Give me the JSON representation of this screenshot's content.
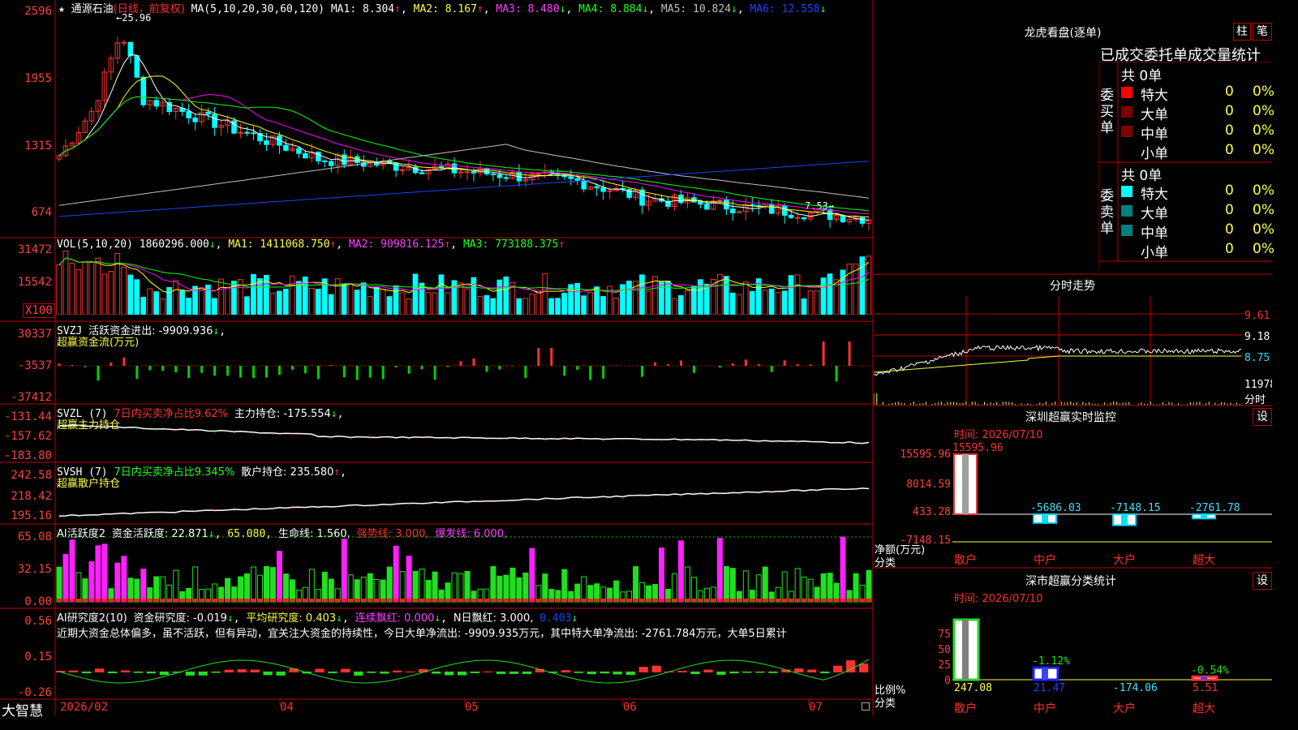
{
  "stock": {
    "name": "通源石油",
    "mode": "(日线，前复权)"
  },
  "colors": {
    "up": "#ff3232",
    "down": "#00ffff",
    "ma1": "#ffffff",
    "ma2": "#ffff00",
    "ma3": "#ff00ff",
    "ma4": "#00ff00",
    "ma5": "#c0c0c0",
    "ma6": "#2040ff",
    "grid": "#c00000"
  },
  "main": {
    "ma_label": "MA(5,10,20,30,60,120)",
    "ma1": "MA1: 8.304",
    "ma2": "MA2: 8.167",
    "ma3": "MA3: 8.480",
    "ma4": "MA4: 8.884",
    "ma5": "MA5: 10.824",
    "ma6": "MA6: 12.558",
    "high_mark": "←25.96",
    "low_mark": "7.53→",
    "yticks": [
      "2596",
      "1955",
      "1315",
      "674"
    ]
  },
  "vol": {
    "label": "VOL(5,10,20)",
    "v": "1860296.000",
    "ma1": "MA1: 1411068.750",
    "ma2": "MA2: 909816.125",
    "ma3": "MA3: 773188.375",
    "yticks": [
      "31472",
      "15542"
    ],
    "unit": "X100"
  },
  "svzj": {
    "label": "SVZJ",
    "t1": "活跃资金进出: -9909.936",
    "t2": "超赢资金流(万元)",
    "yticks": [
      "30337",
      "-3537",
      "-37412"
    ]
  },
  "svzl": {
    "label": "SVZL (7)",
    "t1": "7日内买卖净占比9.62%",
    "t2": "主力持仓: -175.554",
    "t3": "超赢主力持仓",
    "yticks": [
      "-131.44",
      "-157.62",
      "-183.80"
    ]
  },
  "svsh": {
    "label": "SVSH (7)",
    "t1": "7日内买卖净占比9.345%",
    "t2": "散户持仓: 235.580",
    "t3": "超赢散户持仓",
    "yticks": [
      "242.58",
      "218.42",
      "195.16"
    ]
  },
  "ai2": {
    "label": "AI活跃度2",
    "t1": "资金活跃度: 22.871",
    "t2": "65.080,",
    "t3": "生命线: 1.560,",
    "t4": "强势线: 3.000,",
    "t5": "爆发线: 6.000,",
    "yticks": [
      "65.08",
      "32.15",
      "0.00"
    ]
  },
  "ai_r": {
    "label": "AI研究度2(10)",
    "t1": "资金研究度: -0.019",
    "t2": "平均研究度: 0.403",
    "t3": "连续飘红: 0.000",
    "t4": "N日飘红: 3.000,",
    "t5": "0.403",
    "note": "近期大资金总体偏多，虽不活跃，但有异动，宜关注大资金的持续性，今日大单净流出: -9909.935万元，其中特大单净流出: -2761.784万元，大单5日累计",
    "yticks": [
      "0.56",
      "0.15",
      "-0.26"
    ]
  },
  "xaxis": {
    "brand": "大智慧",
    "labels": [
      "2026/02",
      "04",
      "05",
      "06",
      "07"
    ]
  },
  "lhb": {
    "title": "龙虎看盘(逐单)",
    "btn1": "柱",
    "btn2": "笔",
    "header": "已成交委托单成交量统计",
    "buy_label": "委买单",
    "sell_label": "委卖单",
    "buy_total": "共 0单",
    "sell_total": "共 0单",
    "buy_rows": [
      {
        "name": "特大",
        "v": "0",
        "p": "0%",
        "c": "#ff0000"
      },
      {
        "name": "大单",
        "v": "0",
        "p": "0%",
        "c": "#800000"
      },
      {
        "name": "中单",
        "v": "0",
        "p": "0%",
        "c": "#800000"
      },
      {
        "name": "小单",
        "v": "0",
        "p": "0%",
        "c": ""
      }
    ],
    "sell_rows": [
      {
        "name": "特大",
        "v": "0",
        "p": "0%",
        "c": "#00ffff"
      },
      {
        "name": "大单",
        "v": "0",
        "p": "0%",
        "c": "#008080"
      },
      {
        "name": "中单",
        "v": "0",
        "p": "0%",
        "c": "#008080"
      },
      {
        "name": "小单",
        "v": "0",
        "p": "0%",
        "c": ""
      }
    ]
  },
  "fenshi": {
    "title": "分时走势",
    "yticks": [
      "9.61",
      "9.18",
      "8.75"
    ],
    "vol_tick": "11978",
    "vol_label": "分时"
  },
  "monitor": {
    "title": "深圳超赢实时监控",
    "btn": "设",
    "time": "时间: 2026/07/10",
    "yticks": [
      "15595.96",
      "8014.59",
      "433.28",
      "-7148.15"
    ],
    "unit1": "净额(万元)",
    "unit2": "分类",
    "bars": [
      {
        "cat": "散户",
        "value": 15595.96,
        "label": "15595.96"
      },
      {
        "cat": "中户",
        "value": -5686.03,
        "label": "-5686.03"
      },
      {
        "cat": "大户",
        "value": -7148.15,
        "label": "-7148.15"
      },
      {
        "cat": "超大",
        "value": -2761.78,
        "label": "-2761.78"
      }
    ]
  },
  "classify": {
    "title": "深市超赢分类统计",
    "btn": "设",
    "time": "时间: 2026/07/10",
    "yticks": [
      "75",
      "50",
      "25",
      "0"
    ],
    "unit1": "比例%",
    "unit2": "分类",
    "bars": [
      {
        "cat": "散户",
        "pct": 100,
        "bottom": "247.08"
      },
      {
        "cat": "中户",
        "pct": 20,
        "top": "-1.12%",
        "bottom": "21.47"
      },
      {
        "cat": "大户",
        "pct": 0,
        "bottom": "-174.06"
      },
      {
        "cat": "超大",
        "pct": 5,
        "top": "-0.54%",
        "bottom": "5.51"
      }
    ]
  }
}
